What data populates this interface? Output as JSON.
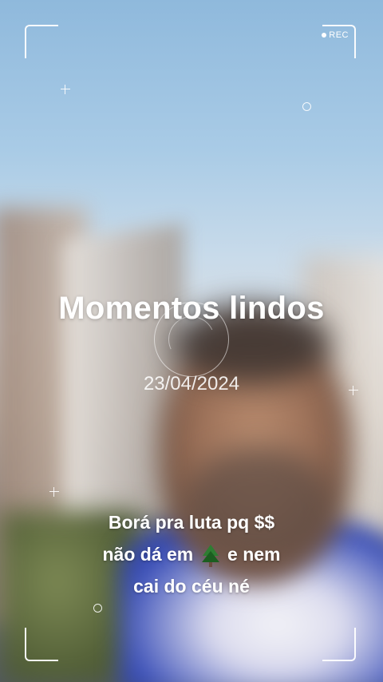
{
  "overlay": {
    "rec_label": "REC",
    "title": "Momentos lindos",
    "date": "23/04/2024"
  },
  "caption": {
    "line1": "Borá pra luta pq $$",
    "line2_before": "não dá em",
    "line2_emoji": "evergreen-tree-icon",
    "line2_after": "e nem",
    "line3": "cai do céu né"
  }
}
